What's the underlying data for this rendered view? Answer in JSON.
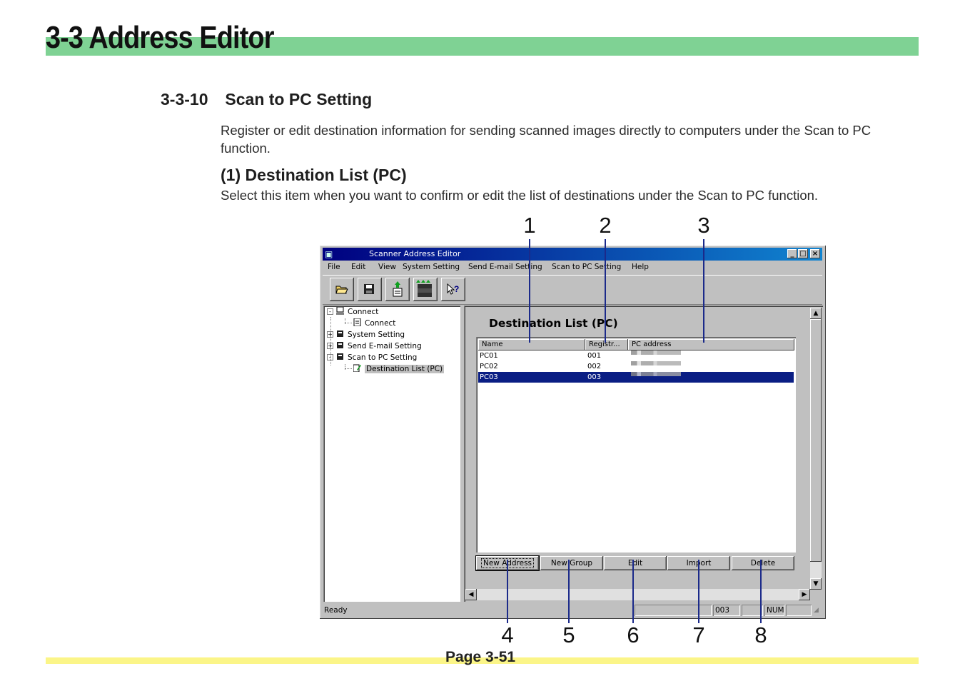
{
  "header": {
    "title": "3-3  Address Editor",
    "band_color": "#7fd294"
  },
  "section": {
    "number": "3-3-10",
    "title": "Scan to PC Setting",
    "intro": "Register or edit destination information for sending scanned images directly to computers under the Scan to PC function."
  },
  "subsection": {
    "title": "(1) Destination List (PC)",
    "text": "Select this item when you want to confirm or edit the list of destinations under the Scan to PC function."
  },
  "callouts": {
    "c1": "1",
    "c2": "2",
    "c3": "3",
    "c4": "4",
    "c5": "5",
    "c6": "6",
    "c7": "7",
    "c8": "8"
  },
  "app": {
    "title": "Scanner Address Editor",
    "title_buttons": {
      "minimize": "_",
      "maximize": "□",
      "close": "×"
    },
    "menu": [
      "File",
      "Edit",
      "View",
      "System Setting",
      "Send E-mail Setting",
      "Scan to PC Setting",
      "Help"
    ],
    "toolbar_icons": [
      "open-folder-icon",
      "save-disk-icon",
      "upload-document-icon",
      "multi-scanner-icon",
      "context-help-icon"
    ],
    "tree": [
      {
        "label": "Connect",
        "expander": "-"
      },
      {
        "label": "Connect"
      },
      {
        "label": "System Setting",
        "expander": "+"
      },
      {
        "label": "Send E-mail Setting",
        "expander": "+"
      },
      {
        "label": "Scan to PC Setting",
        "expander": "-"
      },
      {
        "label": "Destination List (PC)"
      }
    ],
    "pane_title": "Destination List (PC)",
    "columns": [
      "Name",
      "Registr...",
      "PC address"
    ],
    "rows": [
      {
        "name": "PC01",
        "reg": "001"
      },
      {
        "name": "PC02",
        "reg": "002"
      },
      {
        "name": "PC03",
        "reg": "003"
      }
    ],
    "buttons": [
      "New Address",
      "New Group",
      "Edit",
      "Import",
      "Delete"
    ],
    "status": {
      "text": "Ready",
      "count": "003",
      "num": "NUM"
    },
    "scroll": {
      "up": "▲",
      "down": "▼",
      "left": "◀",
      "right": "▶"
    }
  },
  "footer": {
    "page": "Page 3-51",
    "band_color": "#fbf588"
  }
}
